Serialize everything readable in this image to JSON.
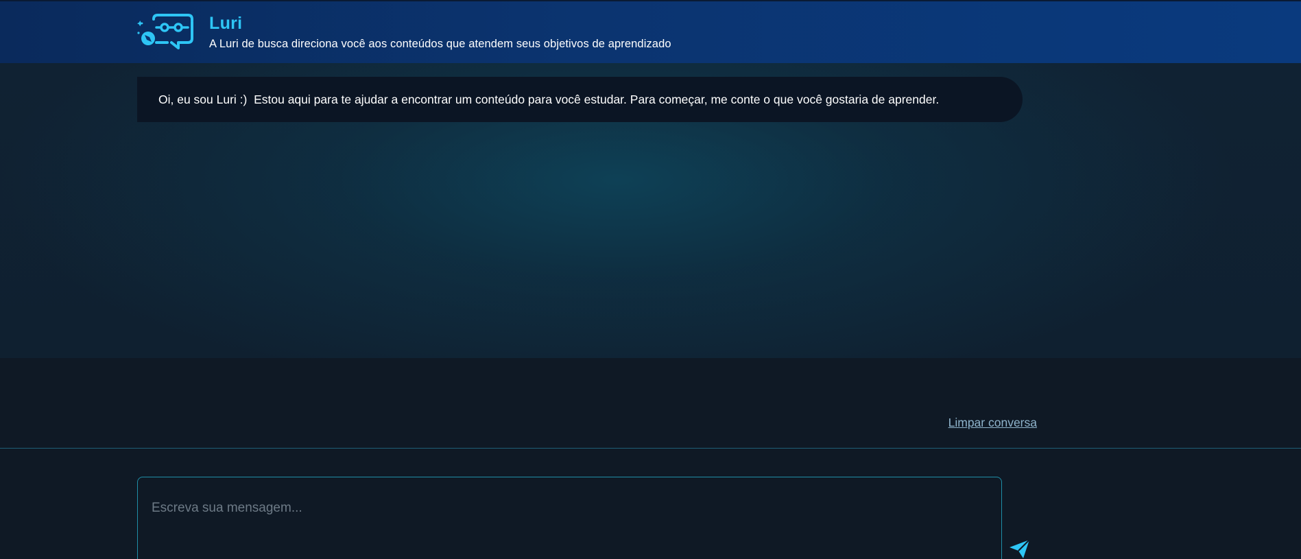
{
  "header": {
    "title": "Luri",
    "subtitle": "A Luri de busca direciona você aos conteúdos que atendem seus objetivos de aprendizado",
    "logo_icon": "chat-bot-compass-icon"
  },
  "chat": {
    "messages": [
      {
        "sender": "Luri",
        "text": "Oi, eu sou Luri :)  Estou aqui para te ajudar a encontrar um conteúdo para você estudar. Para começar, me conte o que você gostaria de aprender."
      }
    ],
    "clear_label": "Limpar conversa"
  },
  "composer": {
    "placeholder": "Escreva sua mensagem...",
    "value": "",
    "send_icon": "send-icon"
  },
  "colors": {
    "accent": "#2ec5f5",
    "header_bg": "#0b3470",
    "page_bg": "#0f1925",
    "bubble_bg": "#0b1524"
  }
}
